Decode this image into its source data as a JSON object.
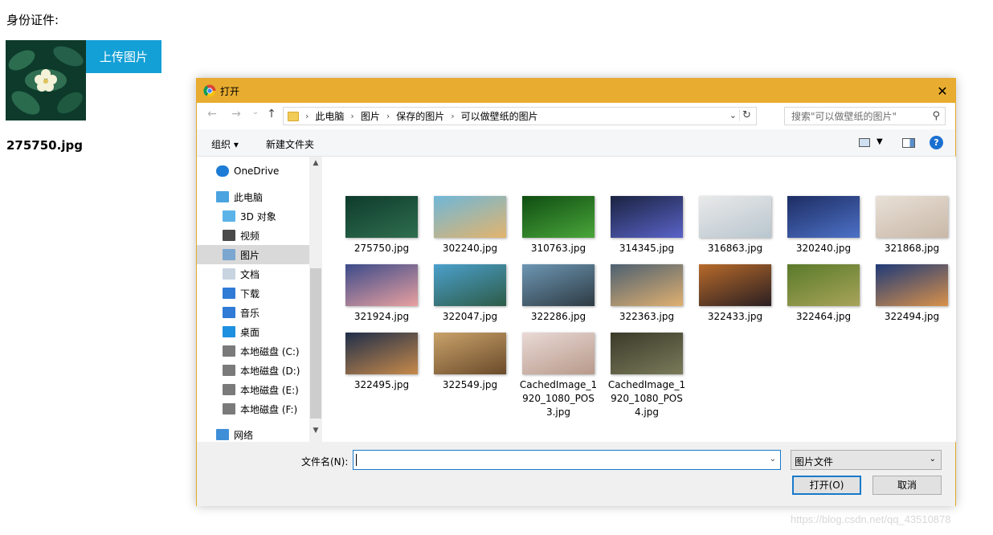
{
  "page": {
    "id_label": "身份证件:",
    "upload_button": "上传图片",
    "file_name": "275750.jpg",
    "watermark": "https://blog.csdn.net/qq_43510878"
  },
  "dialog": {
    "title": "打开",
    "close": "✕",
    "nav": {
      "back": "←",
      "forward": "→",
      "recent": "⌄",
      "up": "↑"
    },
    "breadcrumb": [
      "此电脑",
      "图片",
      "保存的图片",
      "可以做壁纸的图片"
    ],
    "search_placeholder": "搜索\"可以做壁纸的图片\"",
    "toolbar": {
      "organize": "组织 ▾",
      "new_folder": "新建文件夹",
      "help": "?"
    },
    "sidebar": [
      {
        "label": "OneDrive",
        "icon": "cloud-icon"
      },
      {
        "label": "此电脑",
        "icon": "computer-icon"
      },
      {
        "label": "3D 对象",
        "icon": "cube-icon"
      },
      {
        "label": "视频",
        "icon": "video-icon"
      },
      {
        "label": "图片",
        "icon": "pictures-icon",
        "selected": true
      },
      {
        "label": "文档",
        "icon": "document-icon"
      },
      {
        "label": "下载",
        "icon": "download-icon"
      },
      {
        "label": "音乐",
        "icon": "music-icon"
      },
      {
        "label": "桌面",
        "icon": "desktop-icon"
      },
      {
        "label": "本地磁盘 (C:)",
        "icon": "drive-icon"
      },
      {
        "label": "本地磁盘 (D:)",
        "icon": "drive-icon"
      },
      {
        "label": "本地磁盘 (E:)",
        "icon": "drive-icon"
      },
      {
        "label": "本地磁盘 (F:)",
        "icon": "drive-icon"
      },
      {
        "label": "网络",
        "icon": "network-icon"
      }
    ],
    "files": [
      {
        "name": "275750.jpg",
        "colors": [
          "#0e3b2c",
          "#2f6e4f"
        ]
      },
      {
        "name": "302240.jpg",
        "colors": [
          "#6fb7d8",
          "#e3b46c"
        ]
      },
      {
        "name": "310763.jpg",
        "colors": [
          "#0f4d12",
          "#4aa63a"
        ]
      },
      {
        "name": "314345.jpg",
        "colors": [
          "#1a2340",
          "#5a63c8"
        ]
      },
      {
        "name": "316863.jpg",
        "colors": [
          "#e9e9e9",
          "#b9c6cf"
        ]
      },
      {
        "name": "320240.jpg",
        "colors": [
          "#1d2d63",
          "#4d71c7"
        ]
      },
      {
        "name": "321868.jpg",
        "colors": [
          "#e8e0d6",
          "#c9b8a8"
        ]
      },
      {
        "name": "321924.jpg",
        "colors": [
          "#3c4b8a",
          "#e9a0a0"
        ]
      },
      {
        "name": "322047.jpg",
        "colors": [
          "#4ba0cc",
          "#2d5b47"
        ]
      },
      {
        "name": "322286.jpg",
        "colors": [
          "#6d96b3",
          "#2e3b44"
        ]
      },
      {
        "name": "322363.jpg",
        "colors": [
          "#4d6071",
          "#e0b070"
        ]
      },
      {
        "name": "322433.jpg",
        "colors": [
          "#b76a2a",
          "#2a1f22"
        ]
      },
      {
        "name": "322464.jpg",
        "colors": [
          "#5a7a2a",
          "#a8a45a"
        ]
      },
      {
        "name": "322494.jpg",
        "colors": [
          "#1f3a78",
          "#d9914a"
        ]
      },
      {
        "name": "322495.jpg",
        "colors": [
          "#1f2e4a",
          "#c88a4a"
        ]
      },
      {
        "name": "322549.jpg",
        "colors": [
          "#c9a26a",
          "#6a4a2a"
        ]
      },
      {
        "name": "CachedImage_1920_1080_POS3.jpg",
        "colors": [
          "#e9d9d6",
          "#b89a8a"
        ]
      },
      {
        "name": "CachedImage_1920_1080_POS4.jpg",
        "colors": [
          "#3b3a2a",
          "#7a7a5a"
        ]
      }
    ],
    "bottom": {
      "file_name_label": "文件名(N):",
      "file_name_value": "",
      "file_type": "图片文件",
      "open": "打开(O)",
      "cancel": "取消"
    }
  }
}
